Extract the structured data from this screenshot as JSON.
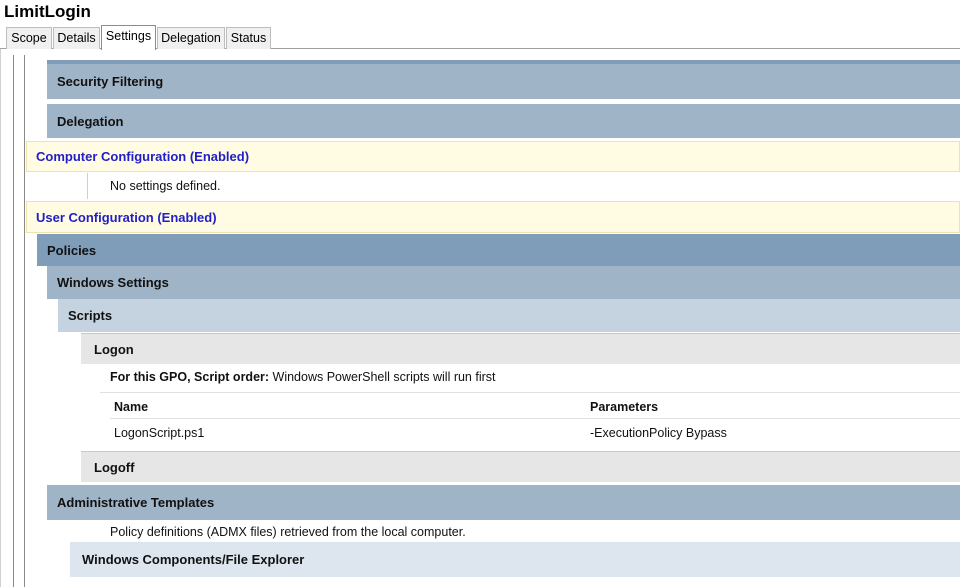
{
  "window": {
    "title": "LimitLogin"
  },
  "tabs": [
    {
      "label": "Scope"
    },
    {
      "label": "Details"
    },
    {
      "label": "Settings"
    },
    {
      "label": "Delegation"
    },
    {
      "label": "Status"
    }
  ],
  "sections": {
    "security_filtering": "Security Filtering",
    "delegation": "Delegation",
    "computer_config": "Computer Configuration (Enabled)",
    "computer_config_note": "No settings defined.",
    "user_config": "User Configuration (Enabled)",
    "policies": "Policies",
    "windows_settings": "Windows Settings",
    "scripts": "Scripts",
    "logon": "Logon",
    "script_order_label": "For this GPO, Script order:",
    "script_order_value": " Windows PowerShell scripts will run first",
    "table": {
      "headers": [
        "Name",
        "Parameters"
      ],
      "rows": [
        [
          "LogonScript.ps1",
          "-ExecutionPolicy Bypass"
        ]
      ]
    },
    "logoff": "Logoff",
    "admin_templates": "Administrative Templates",
    "admin_templates_note": "Policy definitions (ADMX files) retrieved from the local computer.",
    "windows_components": "Windows Components/File Explorer"
  }
}
